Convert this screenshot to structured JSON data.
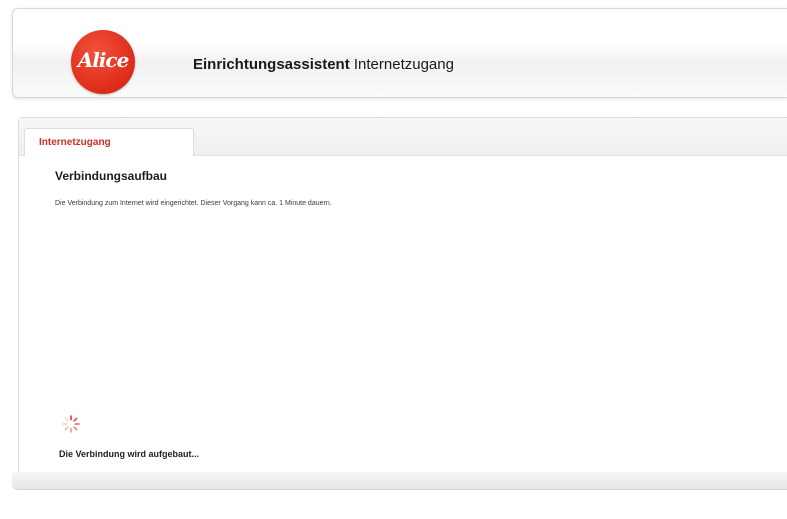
{
  "header": {
    "logo_text": "Alice",
    "title_bold": "Einrichtungsassistent",
    "title_normal": "Internetzugang"
  },
  "tabs": [
    {
      "label": "Internetzugang",
      "active": true
    }
  ],
  "content": {
    "section_title": "Verbindungsaufbau",
    "description": "Die Verbindung zum Internet wird eingerichtet. Dieser Vorgang kann ca. 1 Minute dauern.",
    "status_text": "Die Verbindung wird aufgebaut..."
  },
  "colors": {
    "brand": "#e2331f",
    "tab_label": "#c8302a"
  },
  "icons": {
    "spinner": "loading-spinner-icon"
  }
}
